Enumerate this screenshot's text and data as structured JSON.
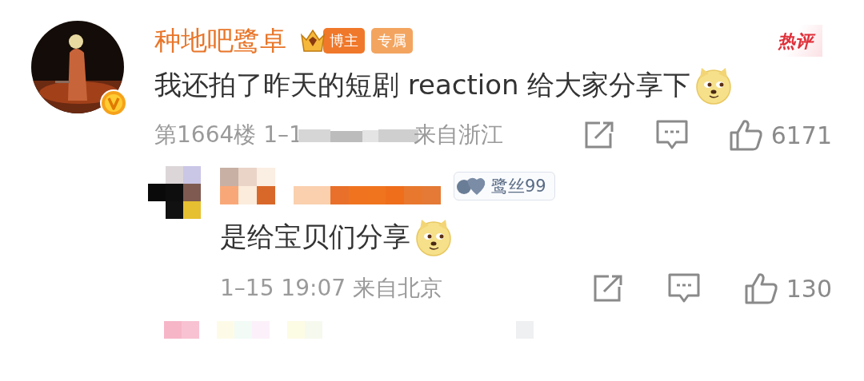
{
  "comment": {
    "name": "种地吧鹭卓",
    "badges": [
      {
        "kind": "crown",
        "label": "博主"
      },
      {
        "kind": "plain",
        "label": "专属"
      }
    ],
    "hot_label": "热评",
    "text": "我还拍了昨天的短剧 reaction 给大家分享下",
    "floor_time": "第1664楼 1–1",
    "location": "来自浙江",
    "likes": "6171",
    "verified": true
  },
  "reply": {
    "fan_badge": "鹭丝99",
    "text": "是给宝贝们分享",
    "meta": "1–15 19:07 来自北京",
    "likes": "130"
  }
}
